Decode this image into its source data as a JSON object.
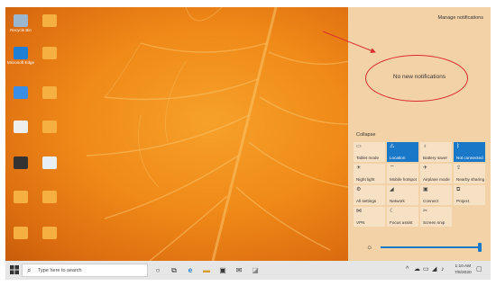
{
  "desktop": {
    "icons": [
      {
        "label": "Recycle Bin",
        "color": "#9ab7cf"
      },
      {
        "label": "",
        "color": "#f5b041"
      },
      {
        "label": "Microsoft Edge",
        "color": "#1e7fd6"
      },
      {
        "label": "",
        "color": "#f5b041"
      },
      {
        "label": "",
        "color": "#3a8ee6"
      },
      {
        "label": "",
        "color": "#f5b041"
      },
      {
        "label": "",
        "color": "#eeeeee"
      },
      {
        "label": "",
        "color": "#f5b041"
      },
      {
        "label": "",
        "color": "#333333"
      },
      {
        "label": "",
        "color": "#e8eef5"
      },
      {
        "label": "",
        "color": "#f5b041"
      },
      {
        "label": "",
        "color": "#f5b041"
      },
      {
        "label": "",
        "color": "#f5b041"
      },
      {
        "label": "",
        "color": "#f5b041"
      }
    ]
  },
  "action_center": {
    "manage_label": "Manage notifications",
    "empty_label": "No new notifications",
    "collapse_label": "Collapse",
    "tiles": [
      {
        "label": "Tablet mode",
        "icon": "tablet-icon",
        "glyph": "▭",
        "active": false
      },
      {
        "label": "Location",
        "icon": "location-icon",
        "glyph": "⚠",
        "active": true
      },
      {
        "label": "Battery saver",
        "icon": "battery-icon",
        "glyph": "♁",
        "active": false
      },
      {
        "label": "Not connected",
        "icon": "bluetooth-icon",
        "glyph": "ᛒ",
        "active": true
      },
      {
        "label": "Night light",
        "icon": "night-light-icon",
        "glyph": "☀",
        "active": false
      },
      {
        "label": "Mobile hotspot",
        "icon": "hotspot-icon",
        "glyph": "⌔",
        "active": false
      },
      {
        "label": "Airplane mode",
        "icon": "airplane-icon",
        "glyph": "✈",
        "active": false
      },
      {
        "label": "Nearby sharing",
        "icon": "nearby-sharing-icon",
        "glyph": "⇪",
        "active": false
      },
      {
        "label": "All settings",
        "icon": "gear-icon",
        "glyph": "⚙",
        "active": false
      },
      {
        "label": "Network",
        "icon": "network-icon",
        "glyph": "◢",
        "active": false
      },
      {
        "label": "Connect",
        "icon": "connect-icon",
        "glyph": "▣",
        "active": false
      },
      {
        "label": "Project",
        "icon": "project-icon",
        "glyph": "⧉",
        "active": false
      },
      {
        "label": "VPN",
        "icon": "vpn-icon",
        "glyph": "⋈",
        "active": false
      },
      {
        "label": "Focus assist",
        "icon": "moon-icon",
        "glyph": "☾",
        "active": false
      },
      {
        "label": "Screen snip",
        "icon": "snip-icon",
        "glyph": "✂",
        "active": false
      }
    ],
    "brightness_fraction": 1.0
  },
  "taskbar": {
    "search_placeholder": "Type here to search",
    "time": "1:10 AM",
    "date": "7/8/2020"
  },
  "colors": {
    "accent": "#1a78c8",
    "annotation": "#d92c2c"
  }
}
